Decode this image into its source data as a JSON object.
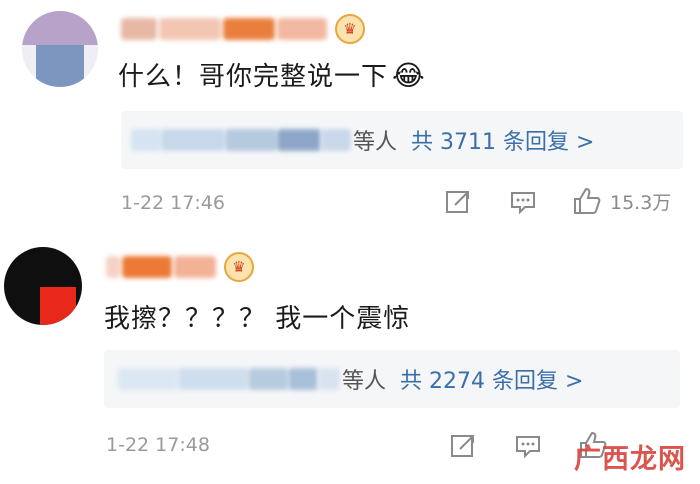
{
  "comments": [
    {
      "text": "什么！哥你完整说一下",
      "emoji": "😂",
      "reply_summary": "等人",
      "reply_count": "共 3711 条回复 >",
      "time": "1-22 17:46",
      "likes": "15.3万"
    },
    {
      "text": "我擦？？？？ 我一个震惊",
      "reply_summary": "等人",
      "reply_count": "共 2274 条回复 >",
      "time": "1-22 17:48",
      "likes": ""
    }
  ],
  "watermark": "广西龙网",
  "icons": {
    "badge": "crown-badge-icon",
    "share": "share-icon",
    "comment": "comment-icon",
    "like": "thumbs-up-icon"
  }
}
